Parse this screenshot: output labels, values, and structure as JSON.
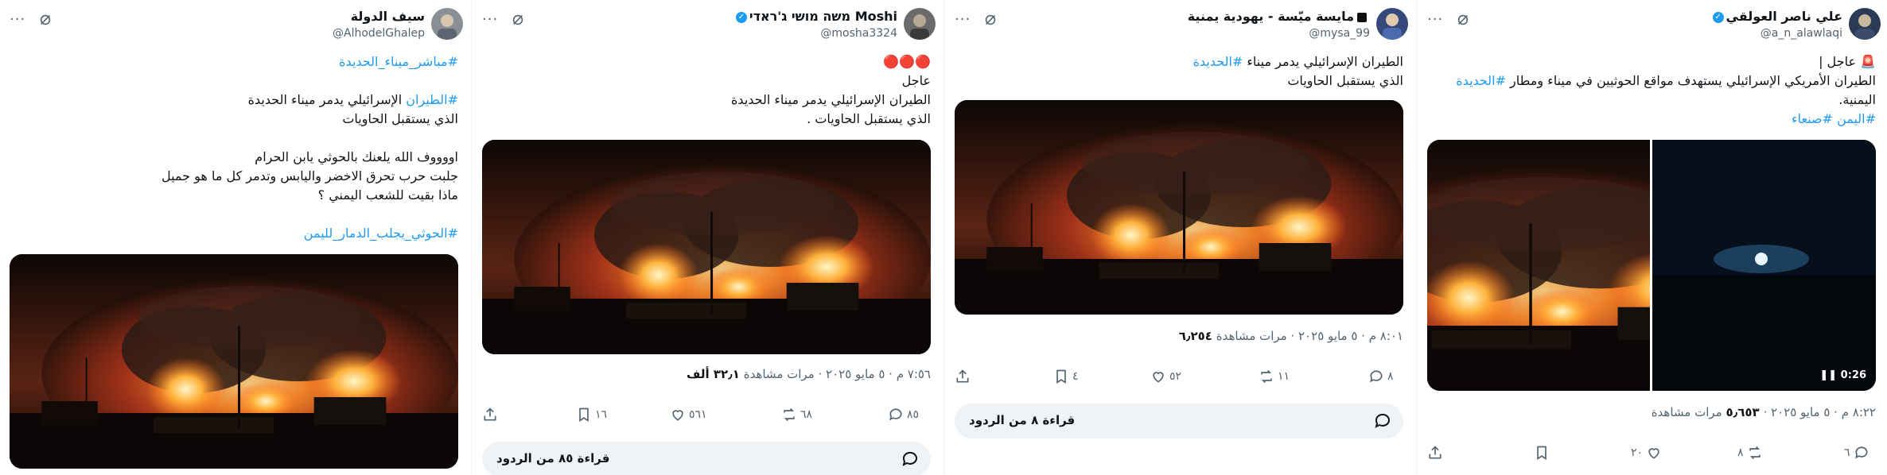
{
  "tweets": [
    {
      "display_name": "علي ناصر العولقي",
      "handle": "@a_n_alawlaqi",
      "lines": [
        "🚨 عاجل |",
        "الطيران الأمريكي الإسرائيلي يستهدف مواقع الحوثيين في ميناء ومطار #الحديدة",
        "اليمنية.",
        "#اليمن #صنعاء"
      ],
      "meta_time": "٨:٢٢ م · ٥ مايو ٢٠٢٥ · ",
      "views": "٥٫٦٥٣",
      "views_label": "مرات مشاهدة",
      "video_duration": "0:26",
      "counts": {
        "reply": "٦",
        "repost": "٨",
        "like": "٢٠",
        "bookmark": "",
        "share": ""
      }
    },
    {
      "display_name": "مايسة ميّسة - يهودية يمنية",
      "handle": "@mysa_99",
      "lines": [
        "الطيران الإسرائيلي يدمر ميناء #الحديدة",
        "الذي يستقبل الحاويات"
      ],
      "meta_time": "٨:٠١ م · ٥ مايو ٢٠٢٥ · ",
      "views": "٦٫٢٥٤",
      "views_label": "مرات مشاهدة",
      "counts": {
        "reply": "٨",
        "repost": "١١",
        "like": "٥٢",
        "bookmark": "٤",
        "share": ""
      },
      "replies_button": "قراءة ٨ من الردود"
    },
    {
      "display_name": "Moshi משה מושי ג'ראדי",
      "handle": "@mosha3324",
      "lines": [
        "🔴🔴🔴",
        "عاجل",
        "الطيران الإسرائيلي يدمر ميناء الحديدة",
        "الذي يستقبل الحاويات ."
      ],
      "meta_time": "٧:٥٦ م · ٥ مايو ٢٠٢٥ · ",
      "views": "٣٢٫١ ألف",
      "views_label": "مرات مشاهدة",
      "counts": {
        "reply": "٨٥",
        "repost": "٦٨",
        "like": "٥٦١",
        "bookmark": "١٦",
        "share": ""
      },
      "replies_button": "قراءة ٨٥ من الردود"
    },
    {
      "display_name": "سيف الدولة",
      "handle": "@AlhodelGhalep",
      "lines": [
        "#مباشر_ميناء_الحديدة",
        "",
        "#الطيران الإسرائيلي يدمر ميناء الحديدة",
        "الذي يستقبل الحاويات",
        "",
        "اووووف الله يلعنك بالحوثي يابن الحرام",
        "جلبت حرب تحرق الاخضر واليابس وتدمر كل ما هو جميل",
        "ماذا بقيت للشعب اليمني ؟",
        "",
        "#الحوثي_يجلب_الدمار_لليمن"
      ]
    }
  ],
  "colors": {
    "link": "#1d9bf0",
    "muted": "#536471",
    "text": "#0f1419"
  }
}
